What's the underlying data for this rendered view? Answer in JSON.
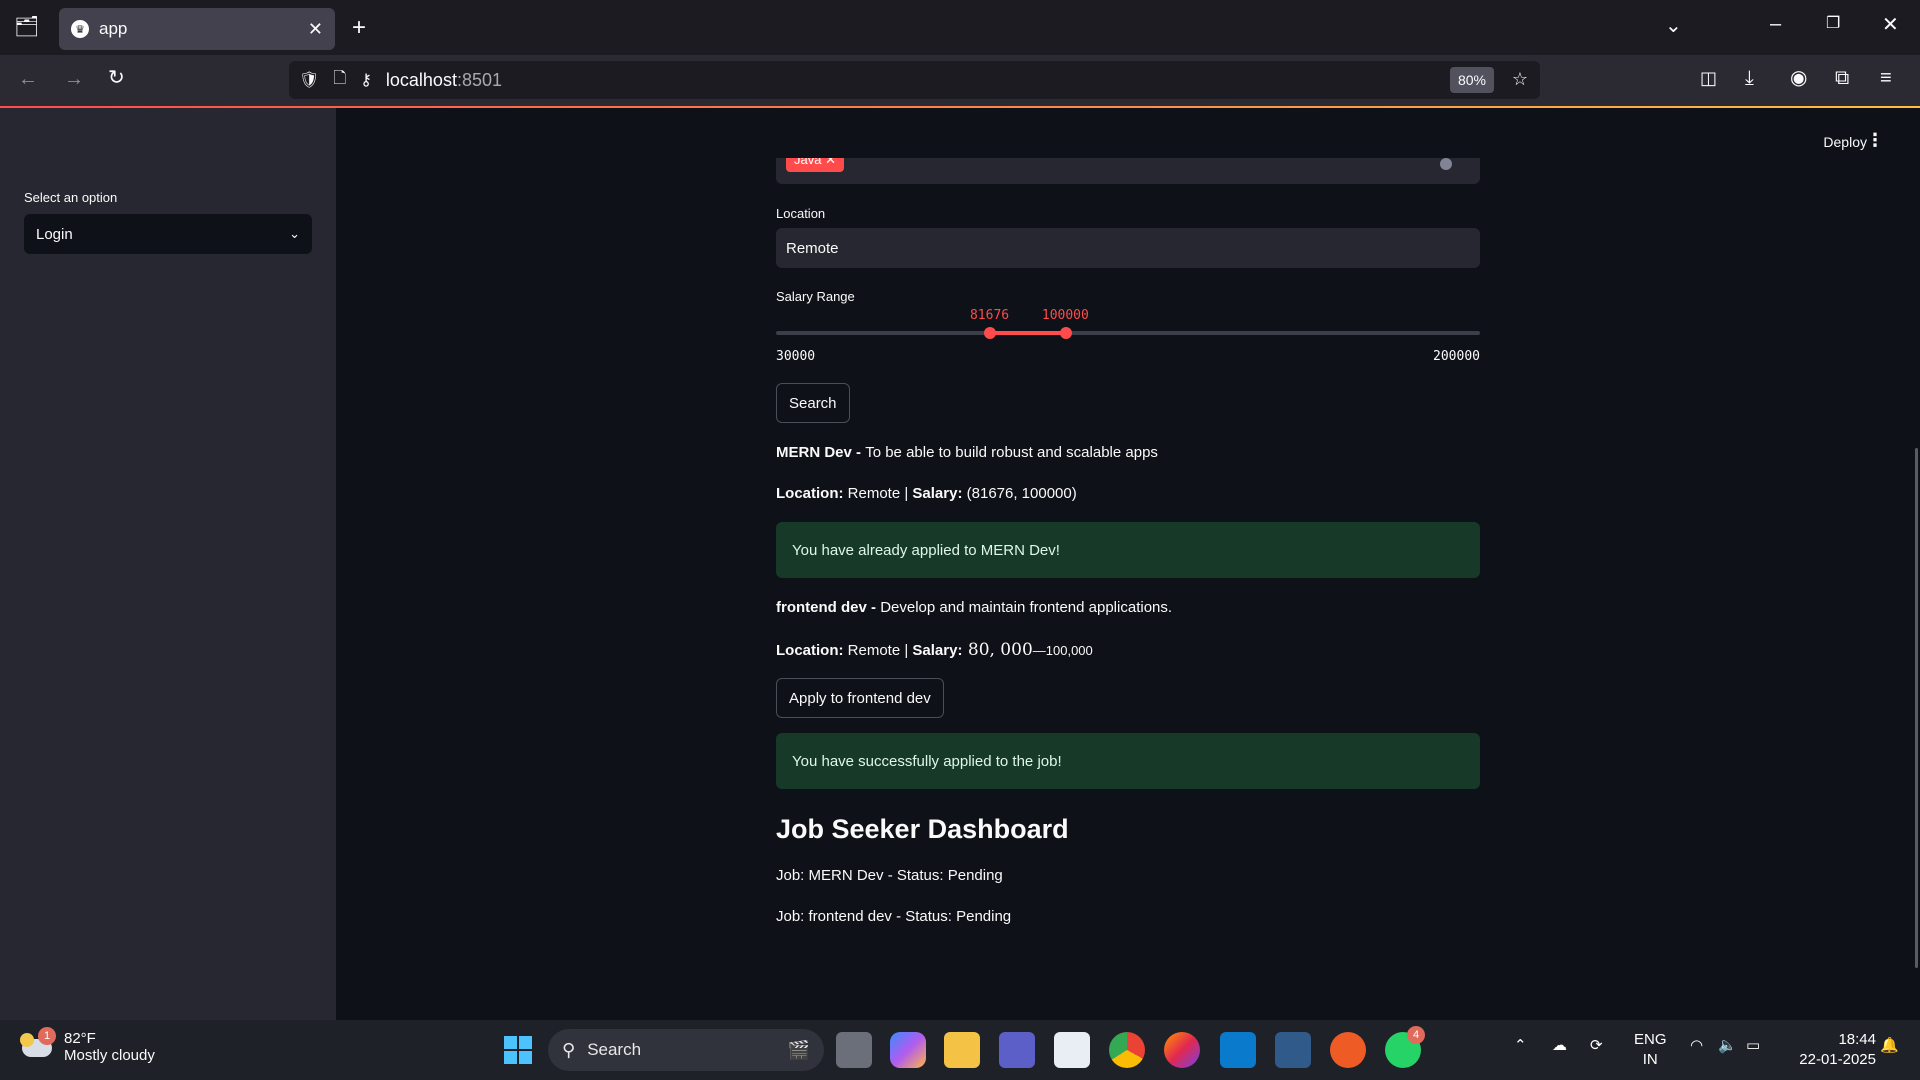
{
  "browser": {
    "tab_title": "app",
    "url_host": "localhost",
    "url_port": ":8501",
    "zoom": "80%"
  },
  "sidebar": {
    "select_label": "Select an option",
    "select_value": "Login"
  },
  "header": {
    "deploy_label": "Deploy"
  },
  "form": {
    "chip_label": "Java",
    "location_label": "Location",
    "location_value": "Remote",
    "salary_label": "Salary Range",
    "salary_low": "81676",
    "salary_high": "100000",
    "salary_min": "30000",
    "salary_max": "200000",
    "salary_min_num": 30000,
    "salary_max_num": 200000,
    "salary_low_num": 81676,
    "salary_high_num": 100000,
    "search_button": "Search"
  },
  "jobs": [
    {
      "title": "MERN Dev",
      "sep": " - ",
      "desc": "To be able to build robust and scalable apps",
      "loc_label": "Location:",
      "loc": " Remote | ",
      "sal_label": "Salary:",
      "sal": " (81676, 100000)",
      "alert": "You have already applied to MERN Dev!"
    },
    {
      "title": "frontend dev",
      "sep": " - ",
      "desc": "Develop and maintain frontend applications.",
      "loc_label": "Location:",
      "loc": " Remote | ",
      "sal_label": "Salary:",
      "sal_math": " 80, 000",
      "sal_rest": "—100,000",
      "apply_button": "Apply to frontend dev",
      "alert": "You have successfully applied to the job!"
    }
  ],
  "dashboard": {
    "title": "Job Seeker Dashboard",
    "rows": [
      "Job: MERN Dev - Status: Pending",
      "Job: frontend dev - Status: Pending"
    ]
  },
  "taskbar": {
    "weather_temp": "82°F",
    "weather_desc": "Mostly cloudy",
    "weather_badge": "1",
    "search_label": "Search",
    "whatsapp_badge": "4",
    "lang_top": "ENG",
    "lang_bottom": "IN",
    "time": "18:44",
    "date": "22-01-2025"
  },
  "colors": {
    "accent": "#ff4b4b",
    "success_bg": "#173928",
    "sidebar_bg": "#262730",
    "main_bg": "#0e1117"
  }
}
